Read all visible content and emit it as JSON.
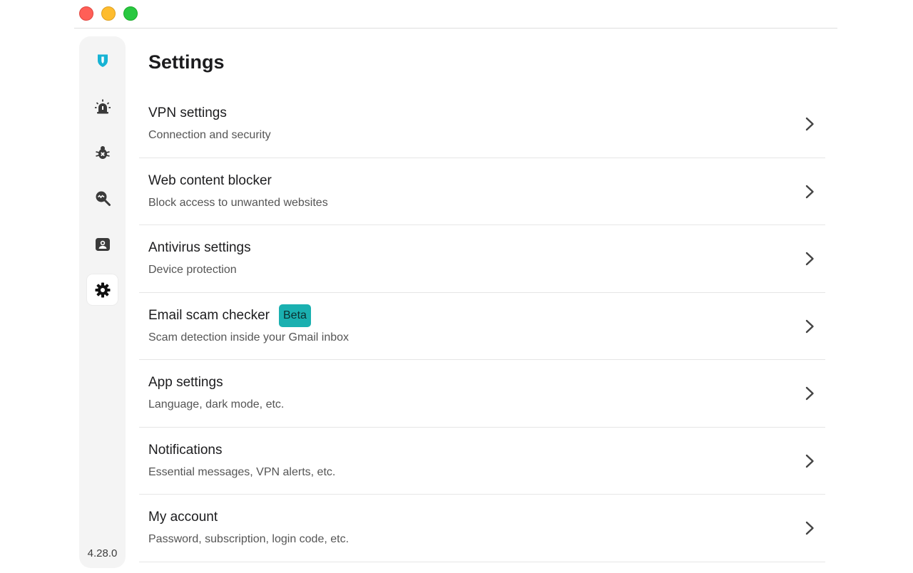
{
  "page": {
    "title": "Settings"
  },
  "app": {
    "version": "4.28.0"
  },
  "colors": {
    "accent": "#1ab0b0",
    "brand": "#17b3d4"
  },
  "sidebar": {
    "items": [
      {
        "name": "shield-icon",
        "label": "Protection"
      },
      {
        "name": "alarm-icon",
        "label": "Alerts"
      },
      {
        "name": "bug-icon",
        "label": "Antivirus"
      },
      {
        "name": "search-scan-icon",
        "label": "Scan"
      },
      {
        "name": "account-icon",
        "label": "Account"
      },
      {
        "name": "gear-icon",
        "label": "Settings",
        "active": true
      }
    ]
  },
  "settings": [
    {
      "title": "VPN settings",
      "subtitle": "Connection and security"
    },
    {
      "title": "Web content blocker",
      "subtitle": "Block access to unwanted websites"
    },
    {
      "title": "Antivirus settings",
      "subtitle": "Device protection"
    },
    {
      "title": "Email scam checker",
      "badge": "Beta",
      "subtitle": "Scam detection inside your Gmail inbox"
    },
    {
      "title": "App settings",
      "subtitle": "Language, dark mode, etc."
    },
    {
      "title": "Notifications",
      "subtitle": "Essential messages, VPN alerts, etc."
    },
    {
      "title": "My account",
      "subtitle": "Password, subscription, login code, etc."
    }
  ]
}
